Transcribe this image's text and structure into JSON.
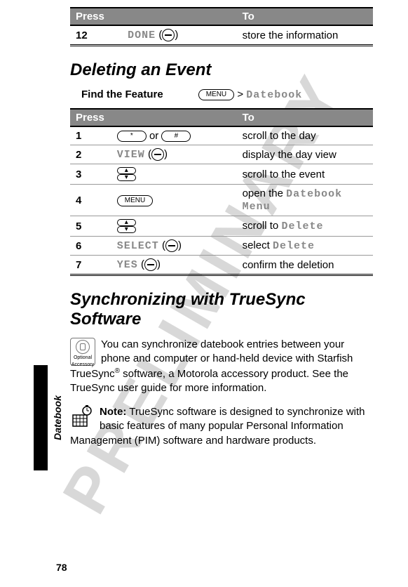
{
  "watermark": "PRELIMINARY",
  "pageNumber": "78",
  "sideTab": "Datebook",
  "table1": {
    "headers": {
      "press": "Press",
      "to": "To"
    },
    "row": {
      "num": "12",
      "label": "DONE",
      "action": "store the information"
    }
  },
  "section1": {
    "heading": "Deleting an Event",
    "featureLabel": "Find the Feature",
    "featurePath": "Datebook",
    "featureSep": ">"
  },
  "table2": {
    "headers": {
      "press": "Press",
      "to": "To"
    },
    "rows": [
      {
        "num": "1",
        "key1": "*",
        "keySep": "or",
        "key2": "#",
        "action": "scroll to the day"
      },
      {
        "num": "2",
        "label": "VIEW",
        "action": "display the day view"
      },
      {
        "num": "3",
        "action": "scroll to the event"
      },
      {
        "num": "4",
        "keyLabel": "MENU",
        "actionPrefix": "open the ",
        "actionSoft": "Datebook Menu"
      },
      {
        "num": "5",
        "actionPrefix": "scroll to ",
        "actionSoft": "Delete"
      },
      {
        "num": "6",
        "label": "SELECT",
        "actionPrefix": "select ",
        "actionSoft": "Delete"
      },
      {
        "num": "7",
        "label": "YES",
        "action": "confirm the deletion"
      }
    ]
  },
  "section2": {
    "heading": "Synchronizing with TrueSync Software",
    "accessoryText": "Optional Accessory",
    "para1a": "You can synchronize datebook entries between your phone and computer or hand-held device with Starfish TrueSync",
    "para1b": " software, a Motorola accessory product. See the TrueSync user guide for more information.",
    "sup": "®",
    "noteLabel": "Note:",
    "notePara": " TrueSync software is designed to synchronize with basic features of many popular Personal Information Management (PIM) software and hardware products."
  },
  "menuKey": "MENU"
}
